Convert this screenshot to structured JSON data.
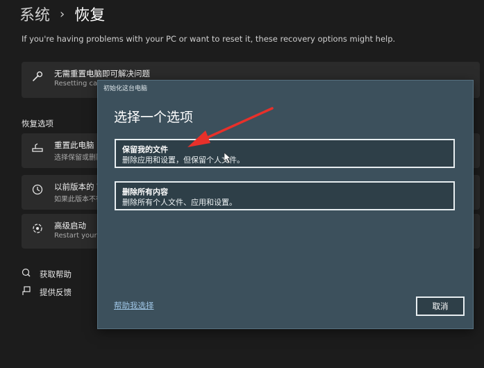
{
  "header": {
    "breadcrumb_parent": "系统",
    "breadcrumb_sep": "›",
    "page_title": "恢复"
  },
  "subtitle": "If you're having problems with your PC or want to reset it, these recovery options might help.",
  "fix_card": {
    "title": "无需重置电脑即可解决问题",
    "desc": "Resetting can",
    "icon": "wrench-icon"
  },
  "section_label": "恢复选项",
  "recovery_options": [
    {
      "title": "重置此电脑",
      "desc": "选择保留或删除",
      "icon": "reset-pc-icon"
    },
    {
      "title": "以前版本的 W",
      "desc": "如果此版本不行",
      "icon": "history-icon"
    },
    {
      "title": "高级启动",
      "desc": "Restart your d",
      "icon": "power-settings-icon"
    }
  ],
  "links": [
    {
      "label": "获取帮助",
      "icon": "help-icon"
    },
    {
      "label": "提供反馈",
      "icon": "feedback-icon"
    }
  ],
  "dialog": {
    "window_title": "初始化这台电脑",
    "heading": "选择一个选项",
    "options": [
      {
        "title": "保留我的文件",
        "desc": "删除应用和设置，但保留个人文件。"
      },
      {
        "title": "删除所有内容",
        "desc": "删除所有个人文件、应用和设置。"
      }
    ],
    "help_link": "帮助我选择",
    "cancel_label": "取消"
  },
  "annotation": {
    "arrow_color": "#e8302a"
  }
}
